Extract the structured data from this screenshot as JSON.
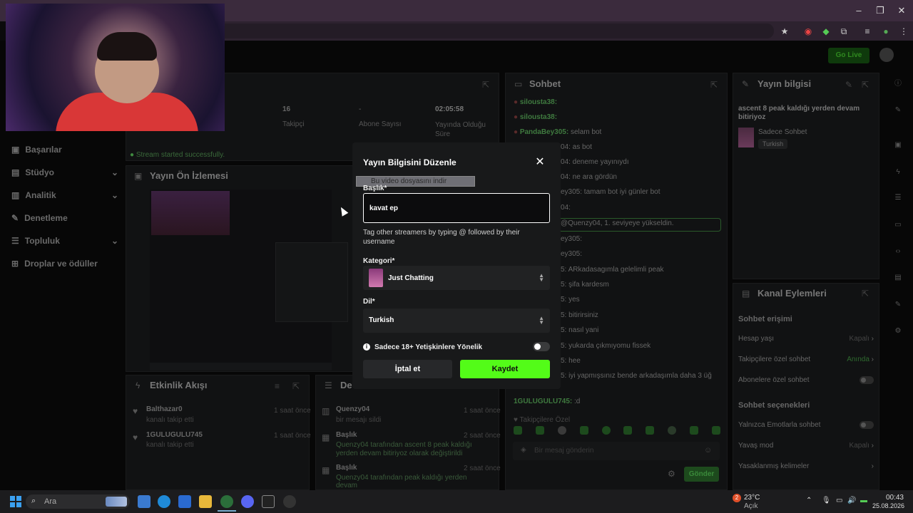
{
  "browser": {
    "window_controls": [
      "–",
      "❐",
      "✕"
    ]
  },
  "app": {
    "go_live": "Go Live"
  },
  "sidebar": {
    "items": [
      {
        "label": "Başarılar",
        "icon": "trophy-icon"
      },
      {
        "label": "Stüdyo",
        "icon": "studio-icon"
      },
      {
        "label": "Analitik",
        "icon": "chart-icon"
      },
      {
        "label": "Denetleme",
        "icon": "wrench-icon"
      },
      {
        "label": "Topluluk",
        "icon": "community-icon"
      },
      {
        "label": "Droplar ve ödüller",
        "icon": "gift-icon"
      }
    ]
  },
  "stats": {
    "followers_value": "16",
    "followers_label": "Takipçi",
    "subs_value": "-",
    "subs_label": "Abone Sayısı",
    "time_value": "02:05:58",
    "time_label": "Yayında Olduğu Süre"
  },
  "notice": "Stream started successfully.",
  "preview": {
    "title": "Yayın Ön İzlemesi"
  },
  "activity": {
    "title": "Etkinlik Akışı",
    "items": [
      {
        "name": "Balthazar0",
        "sub": "kanalı takip etti",
        "time": "1 saat önce"
      },
      {
        "name": "1GULUGULU745",
        "sub": "kanalı takip etti",
        "time": "1 saat önce"
      }
    ]
  },
  "modlog": {
    "title": "De",
    "items": [
      {
        "name": "Quenzy04",
        "sub": "bir mesajı sildi",
        "time": "1 saat önce"
      },
      {
        "name": "Başlık",
        "sub": "Quenzy04 tarafından ascent 8 peak kaldığı yerden devam bitiriyoz olarak değiştirildi",
        "time": "2 saat önce"
      },
      {
        "name": "Başlık",
        "sub": "Quenzy04 tarafından peak kaldığı yerden devam",
        "time": "2 saat önce"
      }
    ]
  },
  "chat": {
    "title": "Sohbet",
    "lines": [
      {
        "user": "silousta38:",
        "text": ""
      },
      {
        "user": "silousta38:",
        "text": ""
      },
      {
        "user": "PandaBey305:",
        "text": "selam bot"
      },
      {
        "user": "",
        "text": "04: as bot"
      },
      {
        "user": "",
        "text": "04: deneme yayınıydı"
      },
      {
        "user": "",
        "text": "04: ne ara gördün"
      },
      {
        "user": "",
        "text": "ey305: tamam bot iyi günler bot"
      },
      {
        "user": "",
        "text": "04:"
      },
      {
        "user": "",
        "text": "@Quenzy04, 1. seviyeye yükseldin."
      },
      {
        "user": "",
        "text": "ey305:"
      },
      {
        "user": "",
        "text": "ey305:"
      },
      {
        "user": "",
        "text": "5: ARkadasagımla gelelimli peak"
      },
      {
        "user": "",
        "text": "5: şifa kardesm"
      },
      {
        "user": "",
        "text": "5: yes"
      },
      {
        "user": "",
        "text": "5: bitirirsiniz"
      },
      {
        "user": "",
        "text": "5: nasıl yani"
      },
      {
        "user": "",
        "text": "5: yukarda çıkmıyomu fissek"
      },
      {
        "user": "",
        "text": "5: hee"
      },
      {
        "user": "",
        "text": "5: iyi yapmışsınız bende arkadaşımla daha 3 üğ"
      },
      {
        "user": "1GULUGULU745:",
        "text": ":d"
      }
    ],
    "followers_only": "Takipçilere Özel",
    "input_placeholder": "Bir mesaj gönderin",
    "send": "Gönder"
  },
  "stream_info": {
    "title": "Yayın bilgisi",
    "stream_title": "ascent 8 peak kaldığı yerden devam bitiriyoz",
    "category": "Sadece Sohbet",
    "language": "Turkish"
  },
  "channel_actions": {
    "title": "Kanal Eylemleri",
    "chat_access": "Sohbet erişimi",
    "account_age": "Hesap yaşı",
    "account_age_value": "Kapalı",
    "followers_chat": "Takipçilere özel sohbet",
    "followers_chat_value": "Anında",
    "subs_chat": "Abonelere özel sohbet",
    "chat_options": "Sohbet seçenekleri",
    "emote_only": "Yalnızca Emotlarla sohbet",
    "slow_mode": "Yavaş mod",
    "slow_mode_value": "Kapalı",
    "banned_words": "Yasaklanmış kelimeler"
  },
  "modal": {
    "title": "Yayın Bilgisini Düzenle",
    "download_overlay": "Bu video dosyasını indir",
    "title_label": "Başlık*",
    "title_value": "kavat ep",
    "hint": "Tag other streamers by typing @ followed by their username",
    "category_label": "Kategori*",
    "category_value": "Just Chatting",
    "language_label": "Dil*",
    "language_value": "Turkish",
    "adult_label": "Sadece 18+ Yetişkinlere Yönelik",
    "cancel": "İptal et",
    "save": "Kaydet"
  },
  "taskbar": {
    "search": "Ara",
    "weather_temp": "23°C",
    "weather_desc": "Açık",
    "time": "00:43",
    "date": "25.08.2026",
    "weather_badge": "2"
  },
  "colors": {
    "accent": "#53fc18",
    "overlay": "#070707",
    "modal_bg": "#18191a"
  }
}
